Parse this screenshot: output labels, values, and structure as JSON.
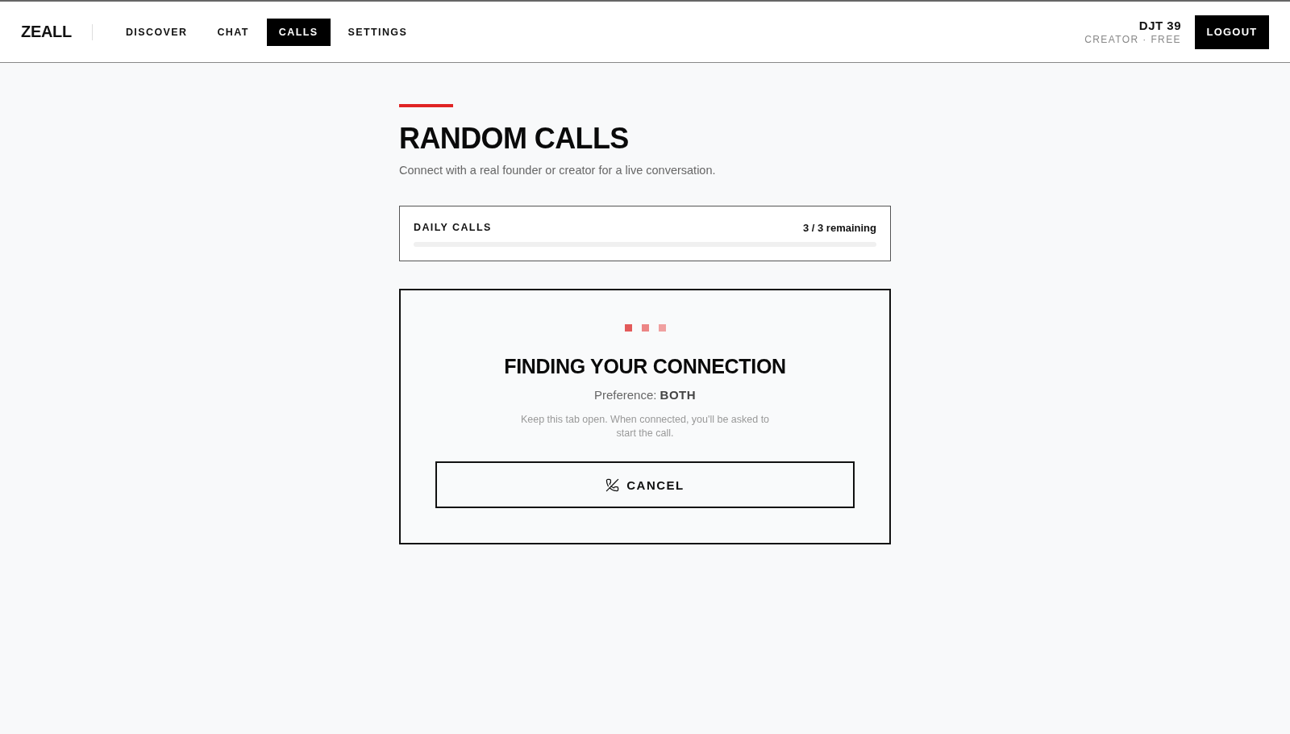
{
  "header": {
    "logo": "ZEALL",
    "nav": [
      {
        "label": "DISCOVER",
        "selected": false
      },
      {
        "label": "CHAT",
        "selected": false
      },
      {
        "label": "CALLS",
        "selected": true
      },
      {
        "label": "SETTINGS",
        "selected": false
      }
    ],
    "user": {
      "name": "DJT 39",
      "plan": "CREATOR · FREE"
    },
    "logout_button": "LOGOUT"
  },
  "page": {
    "title": "RANDOM CALLS",
    "subtitle": "Connect with a real founder or creator for a live conversation."
  },
  "daily_calls": {
    "label": "DAILY CALLS",
    "reading": "3 / 3 remaining"
  },
  "search_card": {
    "title": "FINDING YOUR CONNECTION",
    "preference": "Preference: **BOTH**",
    "hint": "Keep this tab open. When connected, you'll be asked to start the call.",
    "cancel_button": "CANCEL"
  }
}
